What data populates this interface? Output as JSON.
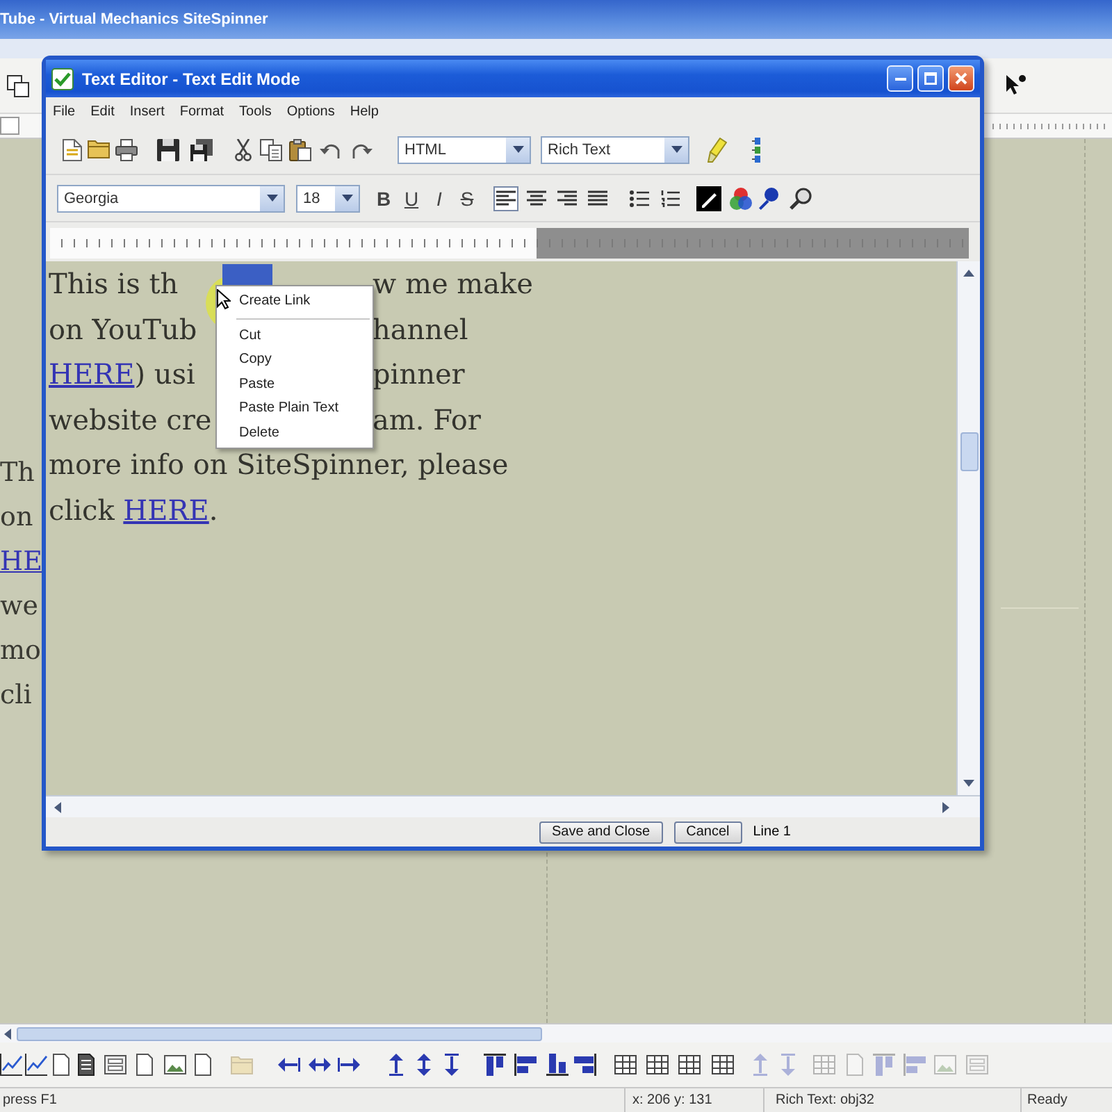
{
  "app_window": {
    "title": "Tube - Virtual Mechanics SiteSpinner"
  },
  "canvas": {
    "page_text": [
      {
        "text": "Th",
        "link": false
      },
      {
        "text": "on",
        "link": false
      },
      {
        "text": "HE",
        "link": true
      },
      {
        "text": "we",
        "link": false
      },
      {
        "text": "mo",
        "link": false
      },
      {
        "text": "cli",
        "link": false
      }
    ]
  },
  "dialog": {
    "title": "Text Editor - Text Edit Mode",
    "menu": [
      "File",
      "Edit",
      "Insert",
      "Format",
      "Tools",
      "Options",
      "Help"
    ],
    "format_select": {
      "value": "HTML"
    },
    "mode_select": {
      "value": "Rich Text"
    },
    "font_select": {
      "value": "Georgia"
    },
    "size_select": {
      "value": "18"
    },
    "style_buttons": [
      {
        "label": "B",
        "kind": "bold"
      },
      {
        "label": "U",
        "kind": "underline"
      },
      {
        "label": "I",
        "kind": "italic"
      },
      {
        "label": "S",
        "kind": "strike"
      }
    ],
    "alignment": [
      {
        "selected": true
      },
      {
        "selected": false
      },
      {
        "selected": false
      },
      {
        "selected": false
      }
    ],
    "editor": {
      "lines": [
        {
          "kind": "split",
          "left": [
            {
              "text": "This is th",
              "link": false
            }
          ],
          "right": [
            {
              "text": "w me make",
              "link": false
            }
          ]
        },
        {
          "kind": "split",
          "left": [
            {
              "text": "on YouTub",
              "link": false
            }
          ],
          "right": [
            {
              "text": "hannel",
              "link": false
            }
          ]
        },
        {
          "kind": "split",
          "left": [
            {
              "text": "HERE",
              "link": true
            },
            {
              "text": ") usi",
              "link": false
            }
          ],
          "right": [
            {
              "text": "pinner",
              "link": false
            }
          ]
        },
        {
          "kind": "split",
          "left": [
            {
              "text": "website cre",
              "link": false
            }
          ],
          "right": [
            {
              "text": "am. For",
              "link": false
            }
          ]
        },
        {
          "kind": "full",
          "runs": [
            {
              "text": "more info on SiteSpinner, please",
              "link": false
            }
          ]
        },
        {
          "kind": "full",
          "runs": [
            {
              "text": "click ",
              "link": false
            },
            {
              "text": "HERE",
              "link": true
            },
            {
              "text": ".",
              "link": false
            }
          ]
        }
      ]
    },
    "context_menu": {
      "items": [
        {
          "kind": "item",
          "label": "Create Link"
        },
        {
          "kind": "separator"
        },
        {
          "kind": "item",
          "label": "Cut"
        },
        {
          "kind": "item",
          "label": "Copy"
        },
        {
          "kind": "item",
          "label": "Paste"
        },
        {
          "kind": "item",
          "label": "Paste Plain Text"
        },
        {
          "kind": "item",
          "label": "Delete"
        }
      ]
    },
    "footer": {
      "buttons": [
        "Save and Close",
        "Cancel"
      ],
      "line_indicator": "Line 1"
    }
  },
  "status_bar": {
    "help": "press F1",
    "coordinates": "x: 206 y: 131",
    "object": "Rich Text: obj32",
    "state": "Ready"
  }
}
